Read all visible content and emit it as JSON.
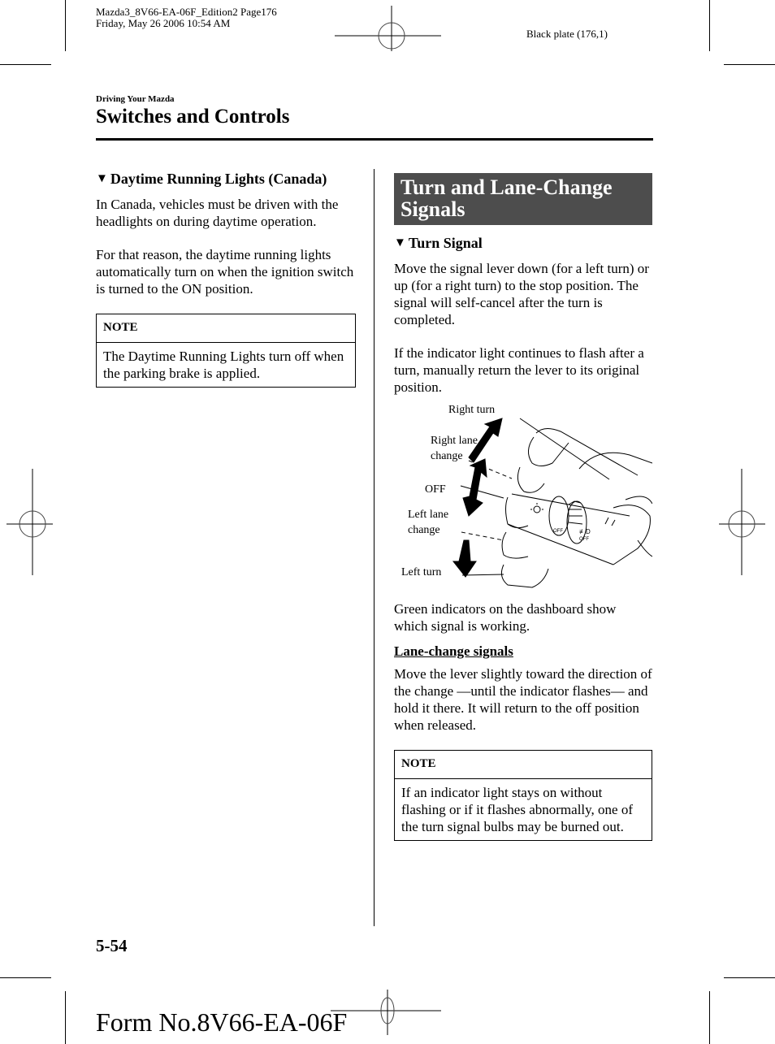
{
  "print_header": {
    "file_line": "Mazda3_8V66-EA-06F_Edition2 Page176",
    "date_line": "Friday, May 26 2006 10:54 AM",
    "plate": "Black plate (176,1)"
  },
  "running_header": {
    "section": "Driving Your Mazda",
    "title": "Switches and Controls"
  },
  "left_column": {
    "heading_icon": "down-triangle-icon",
    "heading_marker": "▼",
    "heading": "Daytime Running Lights (Canada)",
    "paragraphs": [
      "In Canada, vehicles must be driven with the headlights on during daytime operation.",
      "For that reason, the daytime running lights automatically turn on when the ignition switch is turned to the ON position."
    ],
    "note": {
      "label": "NOTE",
      "text": "The Daytime Running Lights turn off when the parking brake is applied."
    }
  },
  "right_column": {
    "section_title": "Turn and Lane-Change Signals",
    "section_banner_color": "#4d4d4d",
    "heading_marker": "▼",
    "heading": "Turn Signal",
    "paragraphs": [
      "Move the signal lever down (for a left turn) or up (for a right turn) to the stop position. The signal will self-cancel after the turn is completed.",
      "If the indicator light continues to flash after a turn, manually return the lever to its original position."
    ],
    "figure": {
      "labels": {
        "right_turn": "Right turn",
        "right_lane_change": "Right lane change",
        "off": "OFF",
        "left_lane_change": "Left lane change",
        "left_turn": "Left turn"
      },
      "lever_text": {
        "off_a": "OFF",
        "off_b": "OFF",
        "fog": "≢D"
      }
    },
    "after_figure": "Green indicators on the dashboard show which signal is working.",
    "lane_change_heading": "Lane-change signals",
    "lane_change_text": "Move the lever slightly toward the direction of the change ―until the indicator flashes― and hold it there. It will return to the off position when released.",
    "note": {
      "label": "NOTE",
      "text": "If an indicator light stays on without flashing or if it flashes abnormally, one of the turn signal bulbs may be burned out."
    }
  },
  "footer": {
    "page_number": "5-54",
    "form_number": "Form No.8V66-EA-06F"
  }
}
